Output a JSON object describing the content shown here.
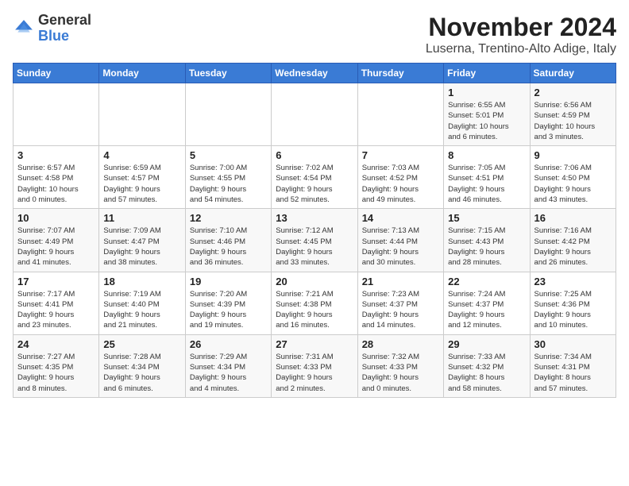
{
  "header": {
    "logo_general": "General",
    "logo_blue": "Blue",
    "month_title": "November 2024",
    "location": "Luserna, Trentino-Alto Adige, Italy"
  },
  "weekdays": [
    "Sunday",
    "Monday",
    "Tuesday",
    "Wednesday",
    "Thursday",
    "Friday",
    "Saturday"
  ],
  "weeks": [
    [
      {
        "day": "",
        "info": ""
      },
      {
        "day": "",
        "info": ""
      },
      {
        "day": "",
        "info": ""
      },
      {
        "day": "",
        "info": ""
      },
      {
        "day": "",
        "info": ""
      },
      {
        "day": "1",
        "info": "Sunrise: 6:55 AM\nSunset: 5:01 PM\nDaylight: 10 hours\nand 6 minutes."
      },
      {
        "day": "2",
        "info": "Sunrise: 6:56 AM\nSunset: 4:59 PM\nDaylight: 10 hours\nand 3 minutes."
      }
    ],
    [
      {
        "day": "3",
        "info": "Sunrise: 6:57 AM\nSunset: 4:58 PM\nDaylight: 10 hours\nand 0 minutes."
      },
      {
        "day": "4",
        "info": "Sunrise: 6:59 AM\nSunset: 4:57 PM\nDaylight: 9 hours\nand 57 minutes."
      },
      {
        "day": "5",
        "info": "Sunrise: 7:00 AM\nSunset: 4:55 PM\nDaylight: 9 hours\nand 54 minutes."
      },
      {
        "day": "6",
        "info": "Sunrise: 7:02 AM\nSunset: 4:54 PM\nDaylight: 9 hours\nand 52 minutes."
      },
      {
        "day": "7",
        "info": "Sunrise: 7:03 AM\nSunset: 4:52 PM\nDaylight: 9 hours\nand 49 minutes."
      },
      {
        "day": "8",
        "info": "Sunrise: 7:05 AM\nSunset: 4:51 PM\nDaylight: 9 hours\nand 46 minutes."
      },
      {
        "day": "9",
        "info": "Sunrise: 7:06 AM\nSunset: 4:50 PM\nDaylight: 9 hours\nand 43 minutes."
      }
    ],
    [
      {
        "day": "10",
        "info": "Sunrise: 7:07 AM\nSunset: 4:49 PM\nDaylight: 9 hours\nand 41 minutes."
      },
      {
        "day": "11",
        "info": "Sunrise: 7:09 AM\nSunset: 4:47 PM\nDaylight: 9 hours\nand 38 minutes."
      },
      {
        "day": "12",
        "info": "Sunrise: 7:10 AM\nSunset: 4:46 PM\nDaylight: 9 hours\nand 36 minutes."
      },
      {
        "day": "13",
        "info": "Sunrise: 7:12 AM\nSunset: 4:45 PM\nDaylight: 9 hours\nand 33 minutes."
      },
      {
        "day": "14",
        "info": "Sunrise: 7:13 AM\nSunset: 4:44 PM\nDaylight: 9 hours\nand 30 minutes."
      },
      {
        "day": "15",
        "info": "Sunrise: 7:15 AM\nSunset: 4:43 PM\nDaylight: 9 hours\nand 28 minutes."
      },
      {
        "day": "16",
        "info": "Sunrise: 7:16 AM\nSunset: 4:42 PM\nDaylight: 9 hours\nand 26 minutes."
      }
    ],
    [
      {
        "day": "17",
        "info": "Sunrise: 7:17 AM\nSunset: 4:41 PM\nDaylight: 9 hours\nand 23 minutes."
      },
      {
        "day": "18",
        "info": "Sunrise: 7:19 AM\nSunset: 4:40 PM\nDaylight: 9 hours\nand 21 minutes."
      },
      {
        "day": "19",
        "info": "Sunrise: 7:20 AM\nSunset: 4:39 PM\nDaylight: 9 hours\nand 19 minutes."
      },
      {
        "day": "20",
        "info": "Sunrise: 7:21 AM\nSunset: 4:38 PM\nDaylight: 9 hours\nand 16 minutes."
      },
      {
        "day": "21",
        "info": "Sunrise: 7:23 AM\nSunset: 4:37 PM\nDaylight: 9 hours\nand 14 minutes."
      },
      {
        "day": "22",
        "info": "Sunrise: 7:24 AM\nSunset: 4:37 PM\nDaylight: 9 hours\nand 12 minutes."
      },
      {
        "day": "23",
        "info": "Sunrise: 7:25 AM\nSunset: 4:36 PM\nDaylight: 9 hours\nand 10 minutes."
      }
    ],
    [
      {
        "day": "24",
        "info": "Sunrise: 7:27 AM\nSunset: 4:35 PM\nDaylight: 9 hours\nand 8 minutes."
      },
      {
        "day": "25",
        "info": "Sunrise: 7:28 AM\nSunset: 4:34 PM\nDaylight: 9 hours\nand 6 minutes."
      },
      {
        "day": "26",
        "info": "Sunrise: 7:29 AM\nSunset: 4:34 PM\nDaylight: 9 hours\nand 4 minutes."
      },
      {
        "day": "27",
        "info": "Sunrise: 7:31 AM\nSunset: 4:33 PM\nDaylight: 9 hours\nand 2 minutes."
      },
      {
        "day": "28",
        "info": "Sunrise: 7:32 AM\nSunset: 4:33 PM\nDaylight: 9 hours\nand 0 minutes."
      },
      {
        "day": "29",
        "info": "Sunrise: 7:33 AM\nSunset: 4:32 PM\nDaylight: 8 hours\nand 58 minutes."
      },
      {
        "day": "30",
        "info": "Sunrise: 7:34 AM\nSunset: 4:31 PM\nDaylight: 8 hours\nand 57 minutes."
      }
    ]
  ]
}
